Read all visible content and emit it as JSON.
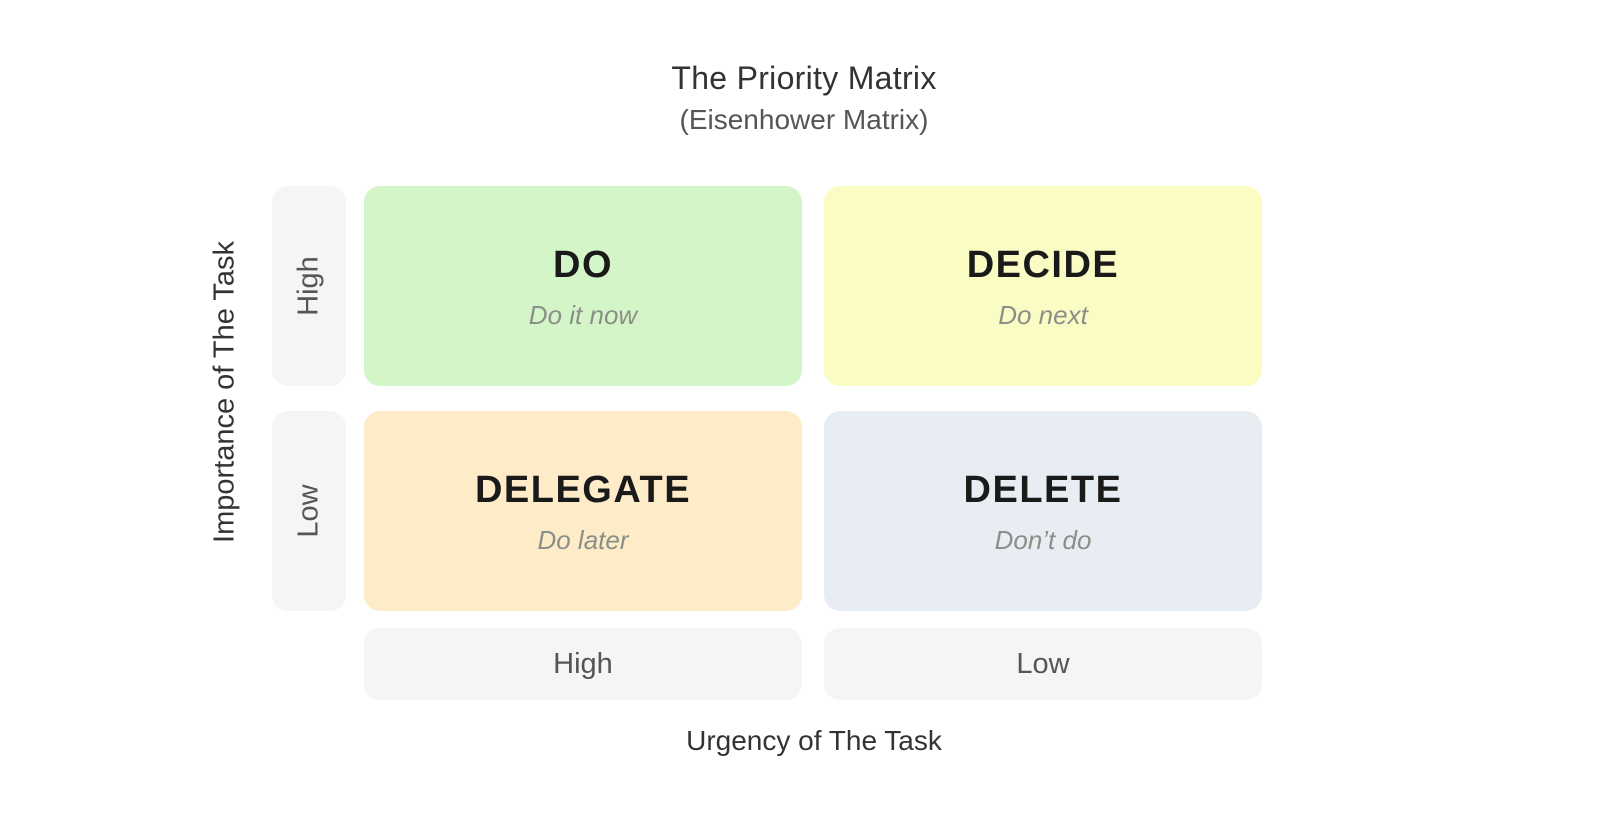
{
  "title": "The Priority Matrix",
  "subtitle": "(Eisenhower Matrix)",
  "axes": {
    "y_label": "Importance of The Task",
    "x_label": "Urgency of The Task",
    "rows": [
      "High",
      "Low"
    ],
    "columns": [
      "High",
      "Low"
    ]
  },
  "quadrants": [
    {
      "title": "DO",
      "subtitle": "Do it now",
      "color": "#d4f5c8"
    },
    {
      "title": "DECIDE",
      "subtitle": "Do next",
      "color": "#fbfbc4"
    },
    {
      "title": "DELEGATE",
      "subtitle": "Do later",
      "color": "#feecc9"
    },
    {
      "title": "DELETE",
      "subtitle": "Don’t do",
      "color": "#e8edf4"
    }
  ]
}
